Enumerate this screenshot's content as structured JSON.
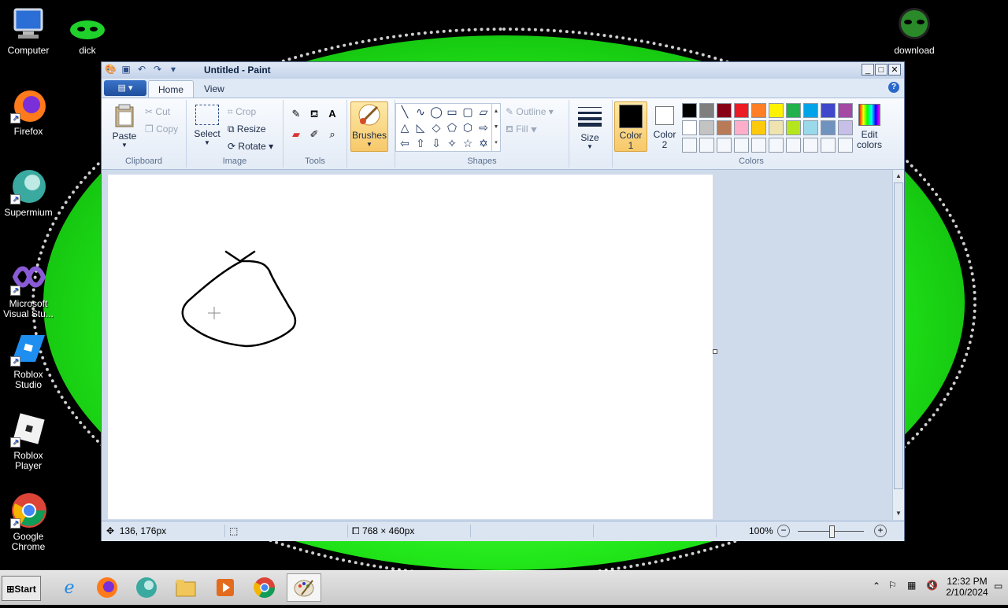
{
  "desktop": {
    "icons": [
      {
        "label": "Computer",
        "icon": "computer-icon"
      },
      {
        "label": "dick",
        "icon": "alien-face-icon"
      },
      {
        "label": "download",
        "icon": "alien-face-icon"
      },
      {
        "label": "Firefox",
        "icon": "firefox-icon"
      },
      {
        "label": "Supermium",
        "icon": "supermium-icon"
      },
      {
        "label": "Microsoft Visual Stu...",
        "icon": "visual-studio-icon"
      },
      {
        "label": "Roblox Studio",
        "icon": "roblox-studio-icon"
      },
      {
        "label": "Roblox Player",
        "icon": "roblox-player-icon"
      },
      {
        "label": "Google Chrome",
        "icon": "chrome-icon"
      }
    ]
  },
  "window": {
    "title": "Untitled - Paint",
    "controls": [
      "minimize",
      "maximize",
      "close"
    ]
  },
  "tabs": [
    {
      "label": "Home",
      "active": true
    },
    {
      "label": "View",
      "active": false
    }
  ],
  "ribbon": {
    "clipboard": {
      "paste": "Paste",
      "cut": "Cut",
      "copy": "Copy",
      "label": "Clipboard"
    },
    "image": {
      "select": "Select",
      "crop": "Crop",
      "resize": "Resize",
      "rotate": "Rotate",
      "label": "Image"
    },
    "tools": {
      "label": "Tools"
    },
    "brushes": {
      "label": "Brushes"
    },
    "shapes": {
      "outline": "Outline",
      "fill": "Fill",
      "label": "Shapes"
    },
    "size": {
      "label": "Size"
    },
    "colors": {
      "color1": "Color\n1",
      "color1_a": "Color",
      "color1_b": "1",
      "color2_a": "Color",
      "color2_b": "2",
      "edit_a": "Edit",
      "edit_b": "colors",
      "label": "Colors",
      "palette_row1": [
        "#000000",
        "#7f7f7f",
        "#880015",
        "#ed1c24",
        "#ff7f27",
        "#fff200",
        "#22b14c",
        "#00a2e8",
        "#3f48cc",
        "#a349a4"
      ],
      "palette_row2": [
        "#ffffff",
        "#c3c3c3",
        "#b97a57",
        "#ffaec9",
        "#ffc90e",
        "#efe4b0",
        "#b5e61d",
        "#99d9ea",
        "#7092be",
        "#c8bfe7"
      ]
    }
  },
  "status": {
    "cursor_pos": "136, 176px",
    "image_size": "768 × 460px",
    "zoom": "100%"
  },
  "taskbar": {
    "start": "Start",
    "time": "12:32 PM",
    "date": "2/10/2024"
  }
}
